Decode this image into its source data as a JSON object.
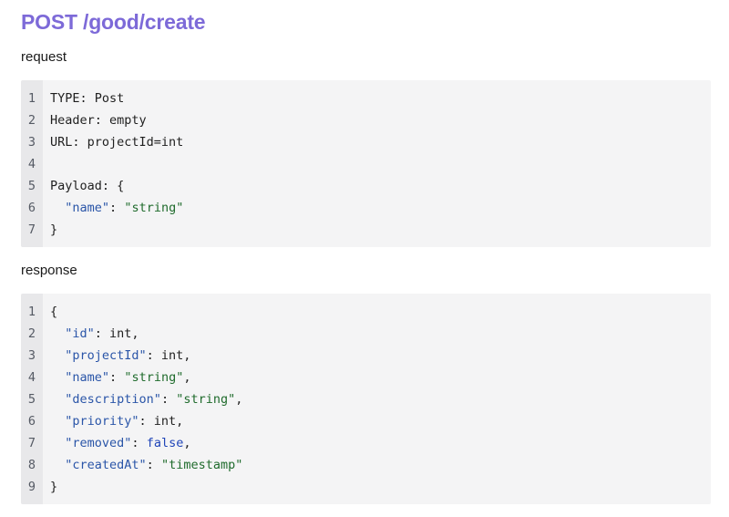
{
  "title": "POST /good/create",
  "request_label": "request",
  "response_label": "response",
  "colors": {
    "title": "#7d6ad8",
    "code_bg": "#f4f4f5",
    "gutter_bg": "#e8e8ea",
    "key": "#2a55a8",
    "string": "#1f6b2c",
    "keyword": "#1f44b8"
  },
  "request": {
    "lines": [
      {
        "n": "1",
        "tokens": [
          {
            "t": "plain",
            "v": "TYPE: Post"
          }
        ]
      },
      {
        "n": "2",
        "tokens": [
          {
            "t": "plain",
            "v": "Header: empty"
          }
        ]
      },
      {
        "n": "3",
        "tokens": [
          {
            "t": "plain",
            "v": "URL: projectId=int"
          }
        ]
      },
      {
        "n": "4",
        "tokens": []
      },
      {
        "n": "5",
        "tokens": [
          {
            "t": "plain",
            "v": "Payload: {"
          }
        ]
      },
      {
        "n": "6",
        "tokens": [
          {
            "t": "plain",
            "v": "  "
          },
          {
            "t": "key",
            "v": "\"name\""
          },
          {
            "t": "plain",
            "v": ": "
          },
          {
            "t": "str",
            "v": "\"string\""
          }
        ]
      },
      {
        "n": "7",
        "tokens": [
          {
            "t": "plain",
            "v": "}"
          }
        ]
      }
    ]
  },
  "response": {
    "lines": [
      {
        "n": "1",
        "tokens": [
          {
            "t": "plain",
            "v": "{"
          }
        ]
      },
      {
        "n": "2",
        "tokens": [
          {
            "t": "plain",
            "v": "  "
          },
          {
            "t": "key",
            "v": "\"id\""
          },
          {
            "t": "plain",
            "v": ": int,"
          }
        ]
      },
      {
        "n": "3",
        "tokens": [
          {
            "t": "plain",
            "v": "  "
          },
          {
            "t": "key",
            "v": "\"projectId\""
          },
          {
            "t": "plain",
            "v": ": int,"
          }
        ]
      },
      {
        "n": "4",
        "tokens": [
          {
            "t": "plain",
            "v": "  "
          },
          {
            "t": "key",
            "v": "\"name\""
          },
          {
            "t": "plain",
            "v": ": "
          },
          {
            "t": "str",
            "v": "\"string\""
          },
          {
            "t": "plain",
            "v": ","
          }
        ]
      },
      {
        "n": "5",
        "tokens": [
          {
            "t": "plain",
            "v": "  "
          },
          {
            "t": "key",
            "v": "\"description\""
          },
          {
            "t": "plain",
            "v": ": "
          },
          {
            "t": "str",
            "v": "\"string\""
          },
          {
            "t": "plain",
            "v": ","
          }
        ]
      },
      {
        "n": "6",
        "tokens": [
          {
            "t": "plain",
            "v": "  "
          },
          {
            "t": "key",
            "v": "\"priority\""
          },
          {
            "t": "plain",
            "v": ": int,"
          }
        ]
      },
      {
        "n": "7",
        "tokens": [
          {
            "t": "plain",
            "v": "  "
          },
          {
            "t": "key",
            "v": "\"removed\""
          },
          {
            "t": "plain",
            "v": ": "
          },
          {
            "t": "kw",
            "v": "false"
          },
          {
            "t": "plain",
            "v": ","
          }
        ]
      },
      {
        "n": "8",
        "tokens": [
          {
            "t": "plain",
            "v": "  "
          },
          {
            "t": "key",
            "v": "\"createdAt\""
          },
          {
            "t": "plain",
            "v": ": "
          },
          {
            "t": "str",
            "v": "\"timestamp\""
          }
        ]
      },
      {
        "n": "9",
        "tokens": [
          {
            "t": "plain",
            "v": "}"
          }
        ]
      }
    ]
  }
}
